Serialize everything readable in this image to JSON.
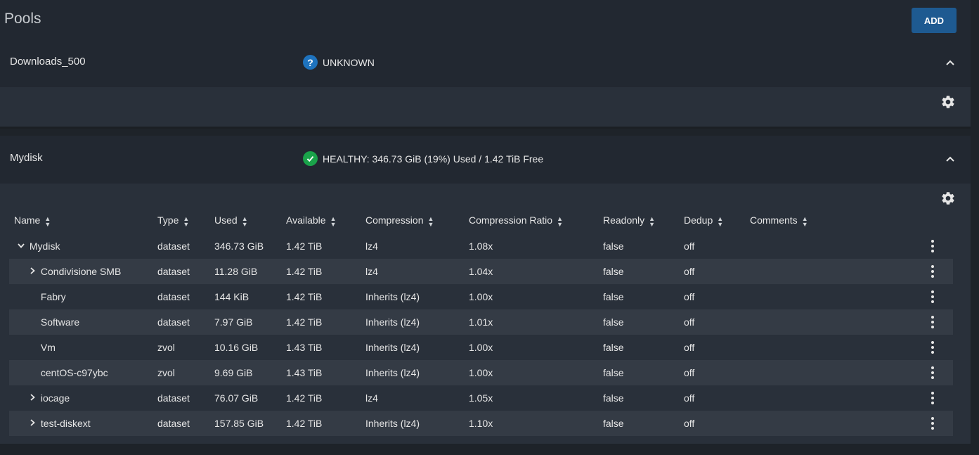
{
  "page": {
    "title": "Pools",
    "add_label": "ADD"
  },
  "pools": [
    {
      "name": "Downloads_500",
      "status_icon": "question-circle-icon",
      "status_color": "#1e73be",
      "status_text": "UNKNOWN"
    },
    {
      "name": "Mydisk",
      "status_icon": "check-circle-icon",
      "status_color": "#1aa34a",
      "status_text": "HEALTHY: 346.73 GiB (19%) Used / 1.42 TiB Free"
    }
  ],
  "table": {
    "columns": [
      "Name",
      "Type",
      "Used",
      "Available",
      "Compression",
      "Compression Ratio",
      "Readonly",
      "Dedup",
      "Comments"
    ],
    "rows": [
      {
        "expander": "expanded",
        "name": "Mydisk",
        "type": "dataset",
        "used": "346.73 GiB",
        "available": "1.42 TiB",
        "compression": "lz4",
        "ratio": "1.08x",
        "readonly": "false",
        "dedup": "off",
        "comments": ""
      },
      {
        "expander": "collapsed",
        "name": "Condivisione SMB",
        "type": "dataset",
        "used": "11.28 GiB",
        "available": "1.42 TiB",
        "compression": "lz4",
        "ratio": "1.04x",
        "readonly": "false",
        "dedup": "off",
        "comments": ""
      },
      {
        "expander": "none",
        "name": "Fabry",
        "type": "dataset",
        "used": "144 KiB",
        "available": "1.42 TiB",
        "compression": "Inherits (lz4)",
        "ratio": "1.00x",
        "readonly": "false",
        "dedup": "off",
        "comments": ""
      },
      {
        "expander": "none",
        "name": "Software",
        "type": "dataset",
        "used": "7.97 GiB",
        "available": "1.42 TiB",
        "compression": "Inherits (lz4)",
        "ratio": "1.01x",
        "readonly": "false",
        "dedup": "off",
        "comments": ""
      },
      {
        "expander": "none",
        "name": "Vm",
        "type": "zvol",
        "used": "10.16 GiB",
        "available": "1.43 TiB",
        "compression": "Inherits (lz4)",
        "ratio": "1.00x",
        "readonly": "false",
        "dedup": "off",
        "comments": ""
      },
      {
        "expander": "none",
        "name": "centOS-c97ybc",
        "type": "zvol",
        "used": "9.69 GiB",
        "available": "1.43 TiB",
        "compression": "Inherits (lz4)",
        "ratio": "1.00x",
        "readonly": "false",
        "dedup": "off",
        "comments": ""
      },
      {
        "expander": "collapsed",
        "name": "iocage",
        "type": "dataset",
        "used": "76.07 GiB",
        "available": "1.42 TiB",
        "compression": "lz4",
        "ratio": "1.05x",
        "readonly": "false",
        "dedup": "off",
        "comments": ""
      },
      {
        "expander": "collapsed",
        "name": "test-diskext",
        "type": "dataset",
        "used": "157.85 GiB",
        "available": "1.42 TiB",
        "compression": "Inherits (lz4)",
        "ratio": "1.10x",
        "readonly": "false",
        "dedup": "off",
        "comments": ""
      }
    ]
  }
}
